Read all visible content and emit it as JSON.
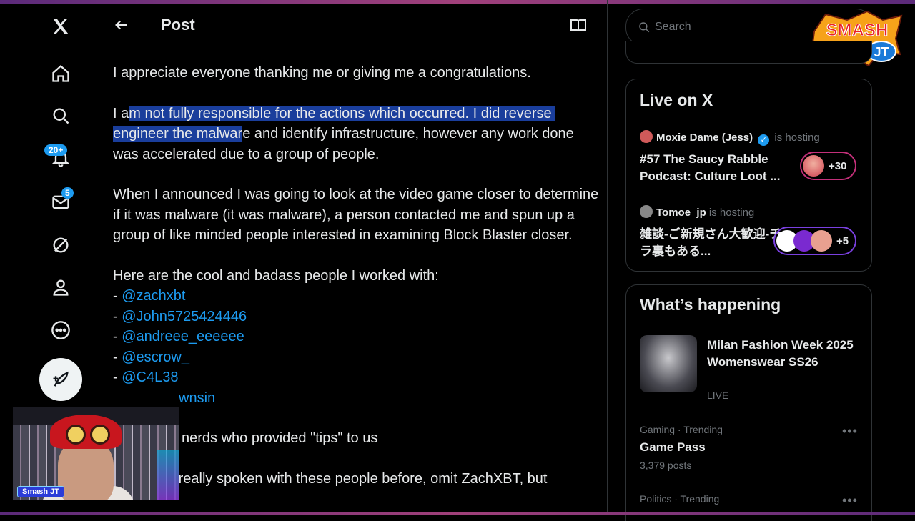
{
  "header": {
    "title": "Post"
  },
  "nav": {
    "notifications_badge": "20+",
    "messages_badge": "5"
  },
  "post": {
    "p1": "I appreciate everyone thanking me or giving me a congratulations.",
    "p2_pre": "I a",
    "p2_highlight": "m not fully responsible for the actions which occurred. I did reverse engineer the malwar",
    "p2_post": "e and identify infrastructure, however any work done was accelerated due to a group of people.",
    "p3": "When I announced I was going to look at the video game closer to determine if it was malware (it was malware), a person contacted me and spun up a group of like minded people interested in examining Block Blaster closer.",
    "p4_intro": "Here are the cool and badass people I worked with:",
    "dash": "- ",
    "mentions": [
      "@zachxbt",
      "@John5725424446",
      "@andreee_eeeeee",
      "@escrow_",
      "@C4L38",
      "wnsin"
    ],
    "p5": "nerds who provided \"tips\" to us",
    "p6": "I've never really spoken with these people before, omit ZachXBT, but"
  },
  "search": {
    "placeholder": "Search"
  },
  "live": {
    "title": "Live on X",
    "items": [
      {
        "host": "Moxie Dame (Jess)",
        "status": "is hosting",
        "title": "#57 The Saucy Rabble Podcast: Culture Loot ...",
        "count": "+30"
      },
      {
        "host": "Tomoe_jp",
        "status": "is hosting",
        "title": "雑談-ご新規さん大歓迎-チラ裏もある...",
        "count": "+5"
      }
    ]
  },
  "happening": {
    "title": "What’s happening",
    "featured": {
      "name": "Milan Fashion Week 2025 Womenswear SS26",
      "status": "LIVE"
    },
    "trends": [
      {
        "category": "Gaming · Trending",
        "name": "Game Pass",
        "posts": "3,379 posts"
      },
      {
        "category": "Politics · Trending"
      }
    ]
  },
  "overlay": {
    "webcam_label": "Smash JT",
    "logo_line1": "SMASH",
    "logo_line2": "JT"
  },
  "colors": {
    "accent": "#1d9bf0",
    "highlight": "#1a3e9c",
    "live_ring": "#c4307a"
  }
}
